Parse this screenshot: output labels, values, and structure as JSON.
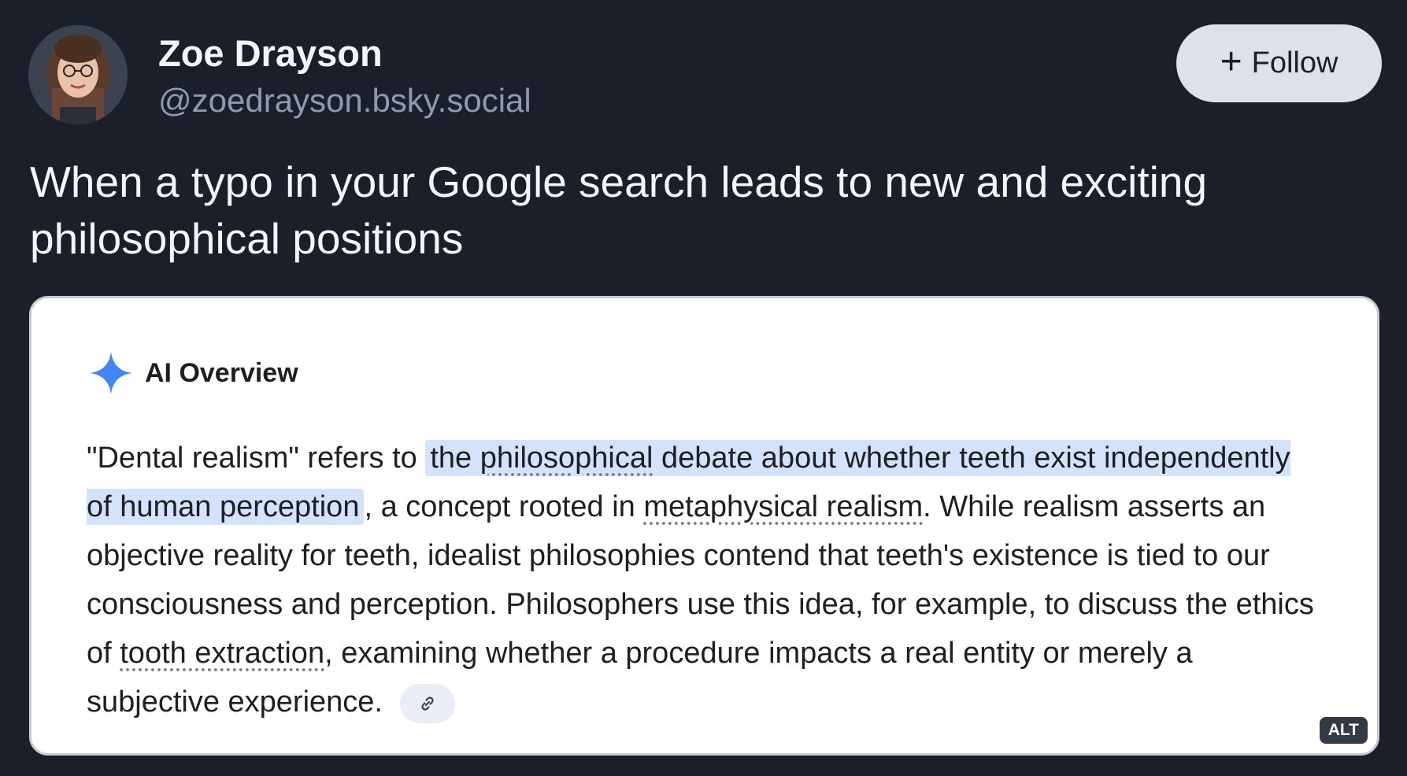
{
  "author": {
    "display_name": "Zoe Drayson",
    "handle": "@zoedrayson.bsky.social",
    "avatar_icon": "avatar-photo"
  },
  "follow_button": {
    "icon": "plus-icon",
    "icon_glyph": "+",
    "label": "Follow"
  },
  "post": {
    "text": "When a typo in your Google search leads to new and exciting philosophical positions"
  },
  "embed_image": {
    "ai_overview": {
      "icon": "sparkle-icon",
      "title": "AI Overview",
      "body": {
        "p1": "\"Dental realism\" refers to ",
        "hl_a": "the ",
        "hl_a_link": "philosophical",
        "hl_b": " debate about whether teeth exist independently of human perception",
        "p2": ", a concept rooted in ",
        "link2": "metaphysical realism",
        "p3": ". While realism asserts an objective reality for teeth, idealist philosophies contend that teeth's existence is tied to our consciousness and perception. Philosophers use this idea, for example, to discuss the ethics of ",
        "link3": "tooth extraction",
        "p4": ", examining whether a procedure impacts a real entity or merely a subjective experience."
      },
      "link_chip_icon": "link-icon"
    },
    "alt_badge": "ALT"
  },
  "colors": {
    "background": "#1b1f29",
    "highlight": "#d3e3fd",
    "sparkle_blue": "#4285f4"
  }
}
